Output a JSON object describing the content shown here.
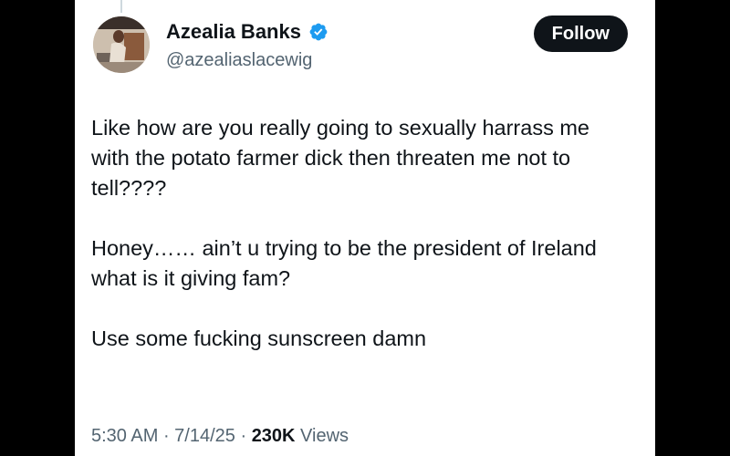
{
  "author": {
    "display_name": "Azealia Banks",
    "handle": "@azealiaslacewig",
    "verified_icon": "verified-badge-icon",
    "verified_color": "#1d9bf0"
  },
  "actions": {
    "follow_label": "Follow"
  },
  "tweet": {
    "paragraphs": [
      "Like how are you really going to sexually harrass me with the potato farmer dick then threaten me not to tell????",
      "Honey…… ain’t u trying to be the president of Ireland what is it giving fam?",
      "Use some fucking sunscreen damn"
    ]
  },
  "meta": {
    "time": "5:30 AM",
    "sep1": " · ",
    "date": "7/14/25",
    "sep2": " · ",
    "views_count": "230K",
    "views_label": " Views"
  },
  "colors": {
    "text_primary": "#0f1419",
    "text_secondary": "#536471",
    "follow_bg": "#0f1419",
    "background": "#ffffff"
  }
}
